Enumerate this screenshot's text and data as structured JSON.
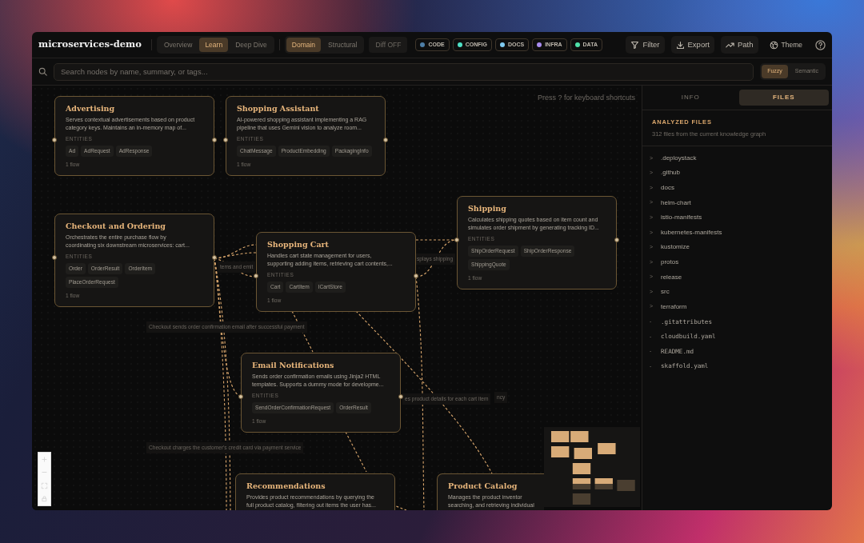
{
  "app_title": "microservices-demo",
  "view_modes": [
    {
      "label": "Overview",
      "selected": false
    },
    {
      "label": "Learn",
      "selected": true
    },
    {
      "label": "Deep Dive",
      "selected": false
    }
  ],
  "lens_modes": [
    {
      "label": "Domain",
      "selected": true
    },
    {
      "label": "Structural",
      "selected": false
    }
  ],
  "diff_toggle": {
    "label": "Diff OFF",
    "on": false
  },
  "type_filters": [
    {
      "label": "CODE",
      "color": "#4e7fa8"
    },
    {
      "label": "CONFIG",
      "color": "#4fe0c6"
    },
    {
      "label": "DOCS",
      "color": "#7fcbf2"
    },
    {
      "label": "INFRA",
      "color": "#a98cf0"
    },
    {
      "label": "DATA",
      "color": "#4fe0a8"
    }
  ],
  "toolbar_buttons": [
    {
      "label": "Filter",
      "kind": "filter"
    },
    {
      "label": "Export",
      "kind": "export"
    },
    {
      "label": "Path",
      "kind": "path"
    },
    {
      "label": "Theme",
      "kind": "theme"
    }
  ],
  "search": {
    "placeholder": "Search nodes by name, summary, or tags..."
  },
  "search_modes": [
    {
      "label": "Fuzzy",
      "selected": true
    },
    {
      "label": "Semantic",
      "selected": false
    }
  ],
  "canvas": {
    "hint": "Press ? for keyboard shortcuts",
    "nodes": [
      {
        "title": "Advertising",
        "summary": [
          "Serves contextual advertisements based on product",
          "category keys. Maintains an in-memory map of..."
        ],
        "entities_label": "ENTITIES",
        "entities": [
          "Ad",
          "AdRequest",
          "AdResponse"
        ],
        "flows": "1 flow"
      },
      {
        "title": "Shopping Assistant",
        "summary": [
          "AI-powered shopping assistant implementing a RAG",
          "pipeline that uses Gemini vision to analyze room..."
        ],
        "entities_label": "ENTITIES",
        "entities": [
          "ChatMessage",
          "ProductEmbedding",
          "PackagingInfo"
        ],
        "flows": "1 flow"
      },
      {
        "title": "Checkout and Ordering",
        "summary": [
          "Orchestrates the entire purchase flow by",
          "coordinating six downstream microservices: cart..."
        ],
        "entities_label": "ENTITIES",
        "entities": [
          "Order",
          "OrderResult",
          "OrderItem",
          "PlaceOrderRequest"
        ],
        "flows": "1 flow"
      },
      {
        "title": "Shopping Cart",
        "summary": [
          "Handles cart state management for users,",
          "supporting adding items, retrieving cart contents,..."
        ],
        "entities_label": "ENTITIES",
        "entities": [
          "Cart",
          "CartItem",
          "ICartStore"
        ],
        "flows": "1 flow"
      },
      {
        "title": "Shipping",
        "summary": [
          "Calculates shipping quotes based on item count and",
          "simulates order shipment by generating tracking ID..."
        ],
        "entities_label": "ENTITIES",
        "entities": [
          "ShipOrderRequest",
          "ShipOrderResponse",
          "ShippingQuote"
        ],
        "flows": "1 flow"
      },
      {
        "title": "Email Notifications",
        "summary": [
          "Sends order confirmation emails using Jinja2 HTML",
          "templates. Supports a dummy mode for developme..."
        ],
        "entities_label": "ENTITIES",
        "entities": [
          "SendOrderConfirmationRequest",
          "OrderResult"
        ],
        "flows": "1 flow"
      },
      {
        "title": "Recommendations",
        "summary": [
          "Provides product recommendations by querying the",
          "full product catalog, filtering out items the user has..."
        ]
      },
      {
        "title": "Product Catalog",
        "summary": [
          "Manages the product inventor",
          "searching, and retrieving individual"
        ]
      }
    ],
    "edge_labels": [
      "splays shipping",
      "tems and emit",
      "Checkout sends order confirmation email after successful payment",
      "es product details for each cart item",
      "ncy",
      "Checkout charges the customer's credit card via payment service"
    ]
  },
  "sidebar": {
    "tabs": [
      {
        "label": "INFO",
        "selected": false
      },
      {
        "label": "FILES",
        "selected": true
      }
    ],
    "section_title": "ANALYZED FILES",
    "section_subtitle": "312 files from the current knowledge graph",
    "files": [
      {
        "marker": ">",
        "name": ".deploystack",
        "kind": "folder"
      },
      {
        "marker": ">",
        "name": ".github",
        "kind": "folder"
      },
      {
        "marker": ">",
        "name": "docs",
        "kind": "folder"
      },
      {
        "marker": ">",
        "name": "helm-chart",
        "kind": "folder"
      },
      {
        "marker": ">",
        "name": "istio-manifests",
        "kind": "folder"
      },
      {
        "marker": ">",
        "name": "kubernetes-manifests",
        "kind": "folder"
      },
      {
        "marker": ">",
        "name": "kustomize",
        "kind": "folder"
      },
      {
        "marker": ">",
        "name": "protos",
        "kind": "folder"
      },
      {
        "marker": ">",
        "name": "release",
        "kind": "folder"
      },
      {
        "marker": ">",
        "name": "src",
        "kind": "folder"
      },
      {
        "marker": ">",
        "name": "terraform",
        "kind": "folder"
      },
      {
        "marker": "-",
        "name": ".gitattributes",
        "kind": "file"
      },
      {
        "marker": "-",
        "name": "cloudbuild.yaml",
        "kind": "file"
      },
      {
        "marker": "-",
        "name": "README.md",
        "kind": "file"
      },
      {
        "marker": "-",
        "name": "skaffold.yaml",
        "kind": "file"
      }
    ]
  }
}
